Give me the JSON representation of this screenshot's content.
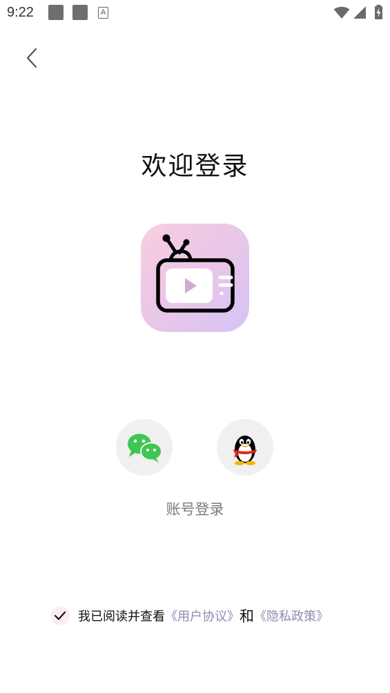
{
  "status_bar": {
    "time": "9:22",
    "notification_icon_a": "A"
  },
  "header": {
    "back_icon": "chevron-left-icon"
  },
  "main": {
    "title": "欢迎登录",
    "app_logo_icon": "tv-play-icon",
    "social_logins": [
      {
        "name": "wechat",
        "icon": "wechat-icon",
        "color": "#3fc553"
      },
      {
        "name": "qq",
        "icon": "qq-penguin-icon",
        "color": "#000000"
      }
    ],
    "account_login_label": "账号登录"
  },
  "agreement": {
    "checked": true,
    "prefix": "我已阅读并查看",
    "user_agreement_link": "《用户协议》",
    "conjunction": "和",
    "privacy_policy_link": "《隐私政策》",
    "link_color": "#8d8ab0"
  },
  "colors": {
    "logo_gradient_start": "#f7cfe0",
    "logo_gradient_end": "#d4c4f5",
    "social_bg": "#f0f0f0",
    "checkbox_bg": "#fbeef2"
  }
}
